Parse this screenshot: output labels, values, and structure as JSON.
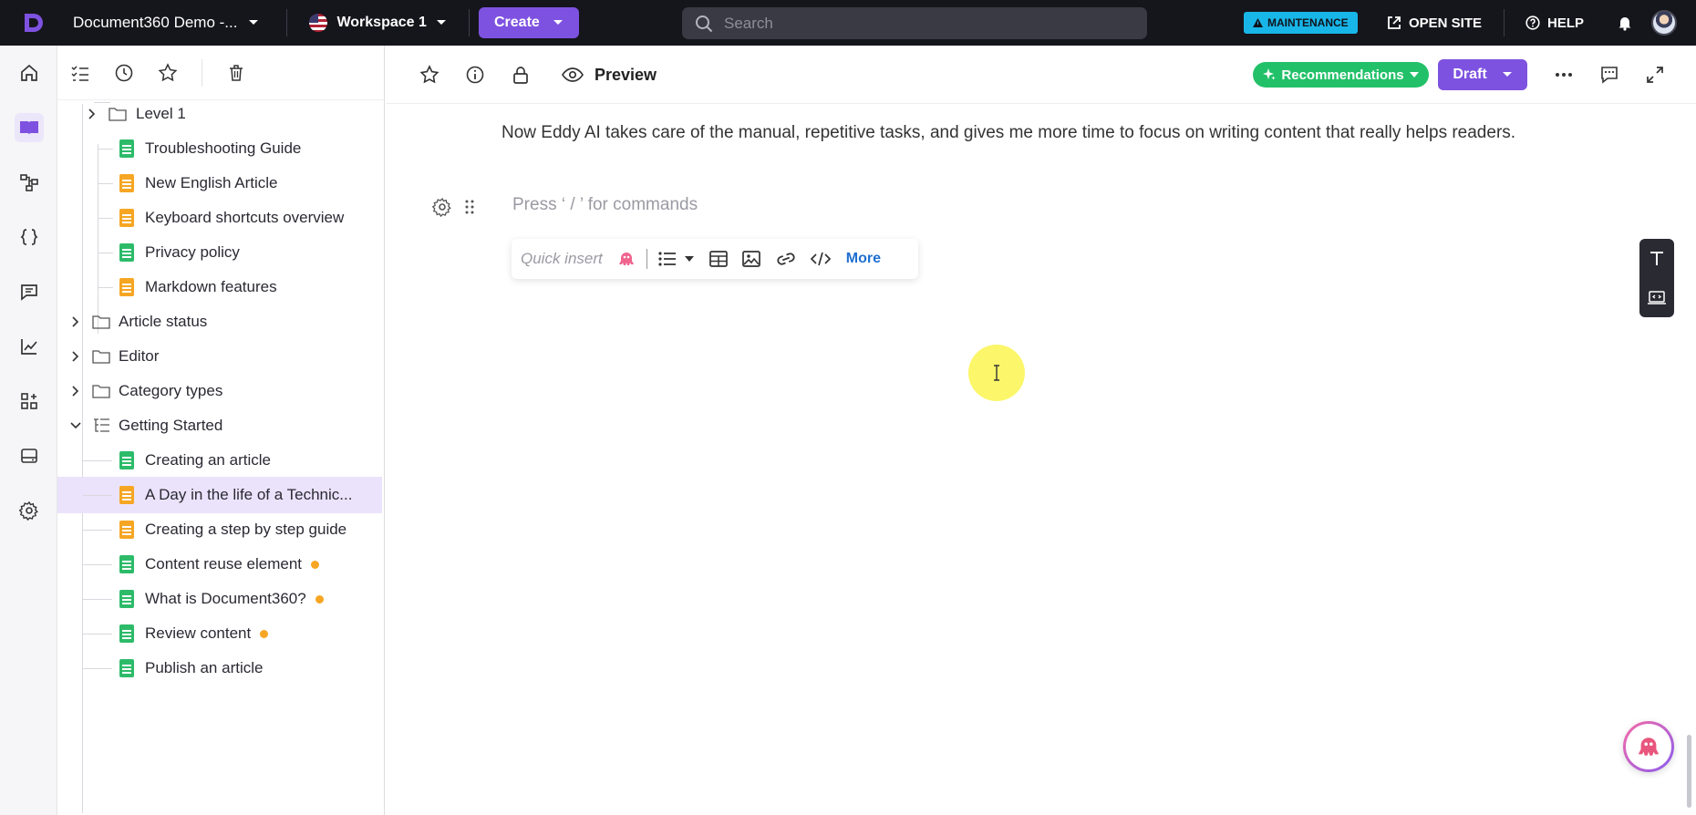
{
  "topbar": {
    "project_name": "Document360 Demo -...",
    "workspace": "Workspace 1",
    "create_label": "Create",
    "search_placeholder": "Search",
    "maintenance_label": "MAINTENANCE",
    "open_site_label": "OPEN SITE",
    "help_label": "HELP"
  },
  "tree": {
    "items": [
      {
        "label": "Level 1",
        "kind": "folder"
      },
      {
        "label": "Troubleshooting Guide",
        "kind": "doc",
        "color": "#2dbb6a"
      },
      {
        "label": "New English Article",
        "kind": "doc",
        "color": "#f6a623"
      },
      {
        "label": "Keyboard shortcuts overview",
        "kind": "doc",
        "color": "#f6a623"
      },
      {
        "label": "Privacy policy",
        "kind": "doc",
        "color": "#2dbb6a"
      },
      {
        "label": "Markdown features",
        "kind": "doc",
        "color": "#f6a623"
      },
      {
        "label": "Article status",
        "kind": "folder"
      },
      {
        "label": "Editor",
        "kind": "folder"
      },
      {
        "label": "Category types",
        "kind": "folder"
      },
      {
        "label": "Getting Started",
        "kind": "index-folder",
        "expanded": true
      },
      {
        "label": "Creating an article",
        "kind": "doc",
        "color": "#2dbb6a"
      },
      {
        "label": "A Day in the life of a Technic...",
        "kind": "doc",
        "color": "#f6a623",
        "selected": true
      },
      {
        "label": "Creating a step by step guide",
        "kind": "doc",
        "color": "#f6a623"
      },
      {
        "label": "Content reuse element",
        "kind": "doc",
        "color": "#2dbb6a",
        "pending": true
      },
      {
        "label": "What is Document360?",
        "kind": "doc",
        "color": "#2dbb6a",
        "pending": true
      },
      {
        "label": "Review content",
        "kind": "doc",
        "color": "#2dbb6a",
        "pending": true
      },
      {
        "label": "Publish an article",
        "kind": "doc",
        "color": "#2dbb6a"
      }
    ]
  },
  "editor": {
    "preview_label": "Preview",
    "recommendations_label": "Recommendations",
    "status_label": "Draft",
    "paragraph": "Now Eddy AI takes care of the manual, repetitive tasks, and gives me more time to focus on writing content that really helps readers.",
    "command_placeholder": "Press ‘ / ’ for commands",
    "quick_insert_label": "Quick insert",
    "more_label": "More"
  },
  "colors": {
    "accent": "#7e52e0",
    "success": "#22c169",
    "maintenance": "#18b6e8",
    "topbar": "#15151c"
  }
}
